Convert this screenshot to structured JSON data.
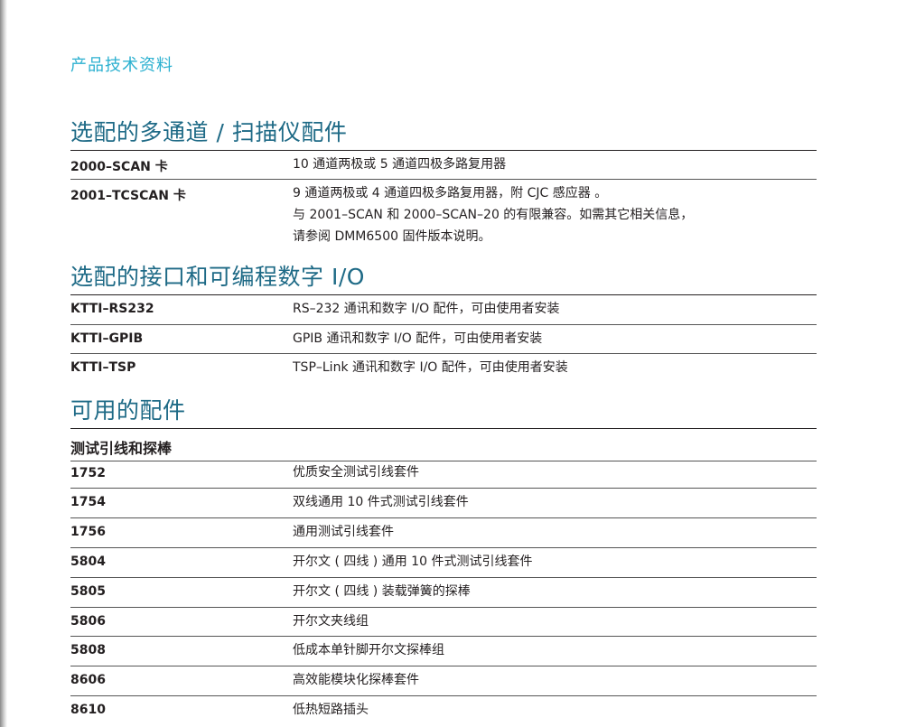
{
  "doc_label": "产品技术资料",
  "sections": [
    {
      "title": "选配的多通道 / 扫描仪配件",
      "rows": [
        {
          "key": "2000–SCAN 卡",
          "lines": [
            "10 通道两极或 5 通道四极多路复用器"
          ]
        },
        {
          "key": "2001–TCSCAN 卡",
          "lines": [
            "9 通道两极或 4 通道四极多路复用器，附 CJC 感应器 。",
            "与 2001–SCAN 和 2000–SCAN–20 的有限兼容。如需其它相关信息，",
            "请参阅 DMM6500 固件版本说明。"
          ]
        }
      ]
    },
    {
      "title": "选配的接口和可编程数字 I/O",
      "rows": [
        {
          "key": "KTTI–RS232",
          "lines": [
            "RS–232 通讯和数字 I/O 配件，可由使用者安装"
          ]
        },
        {
          "key": "KTTI–GPIB",
          "lines": [
            "GPIB 通讯和数字 I/O 配件，可由使用者安装"
          ]
        },
        {
          "key": "KTTI–TSP",
          "lines": [
            "TSP–Link 通讯和数字 I/O 配件，可由使用者安装"
          ]
        }
      ]
    },
    {
      "title": "可用的配件",
      "subtitle": "测试引线和探棒",
      "rows": [
        {
          "key": "1752",
          "lines": [
            "优质安全测试引线套件"
          ]
        },
        {
          "key": "1754",
          "lines": [
            "双线通用 10 件式测试引线套件"
          ]
        },
        {
          "key": "1756",
          "lines": [
            "通用测试引线套件"
          ]
        },
        {
          "key": "5804",
          "lines": [
            "开尔文 ( 四线 ) 通用 10 件式测试引线套件"
          ]
        },
        {
          "key": "5805",
          "lines": [
            "开尔文 ( 四线 ) 装载弹簧的探棒"
          ]
        },
        {
          "key": "5806",
          "lines": [
            "开尔文夹线组"
          ]
        },
        {
          "key": "5808",
          "lines": [
            "低成本单针脚开尔文探棒组"
          ]
        },
        {
          "key": "8606",
          "lines": [
            "高效能模块化探棒套件"
          ]
        },
        {
          "key": "8610",
          "lines": [
            "低热短路插头"
          ]
        }
      ]
    }
  ]
}
